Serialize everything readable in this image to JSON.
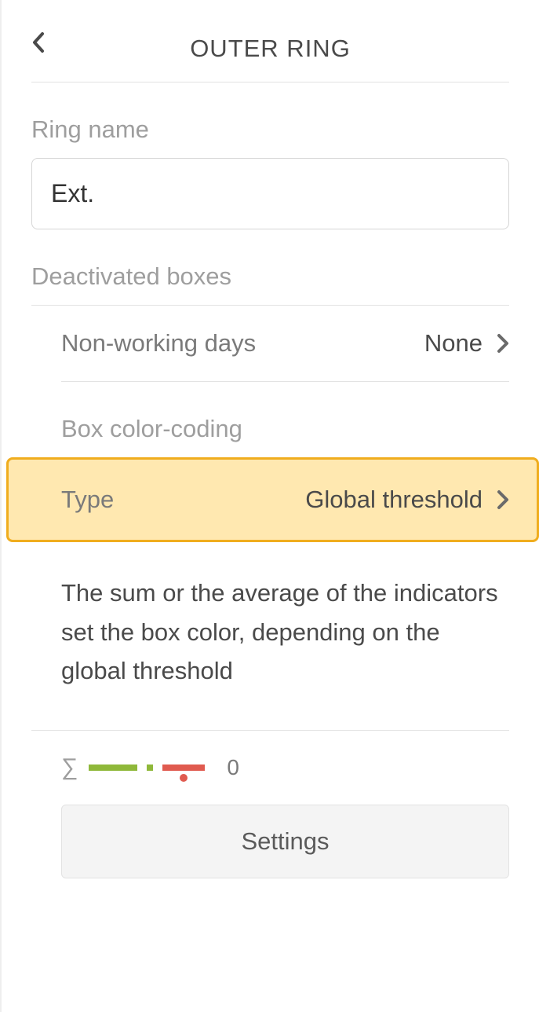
{
  "header": {
    "title": "OUTER RING"
  },
  "ringName": {
    "label": "Ring name",
    "value": "Ext."
  },
  "deactivated": {
    "label": "Deactivated boxes",
    "nonWorking": {
      "label": "Non-working days",
      "value": "None"
    }
  },
  "boxColor": {
    "label": "Box color-coding",
    "type": {
      "label": "Type",
      "value": "Global threshold"
    },
    "description": "The sum or the average of the indicators set the box color, depending on the global threshold",
    "thresholdValue": "0",
    "settingsLabel": "Settings"
  }
}
